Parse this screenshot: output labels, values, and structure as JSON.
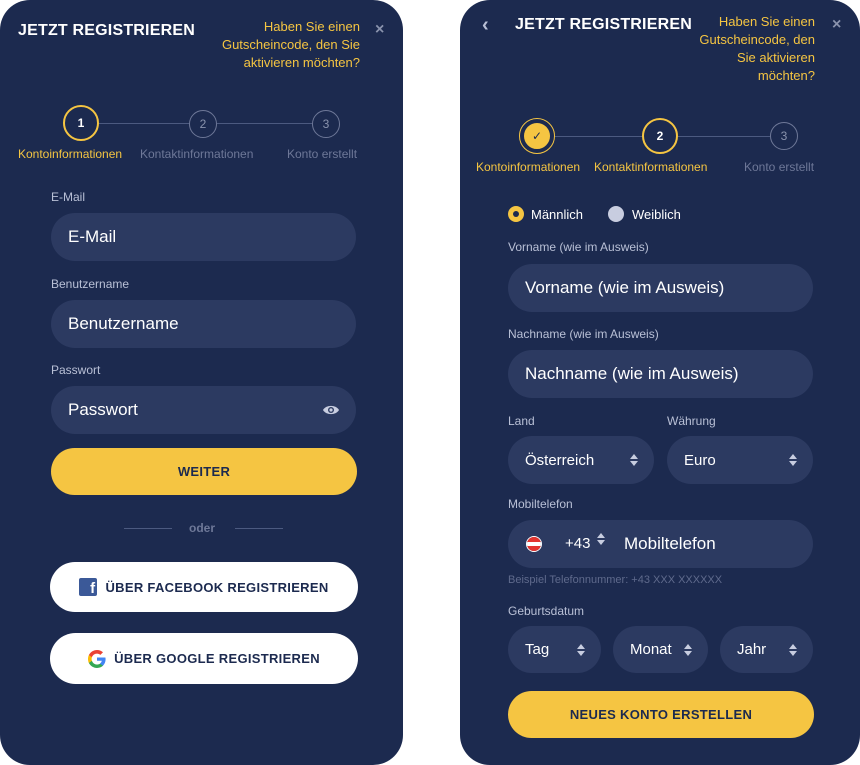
{
  "screen1": {
    "title": "JETZT REGISTRIEREN",
    "voucher_text": "Haben Sie einen Gutscheincode, den Sie aktivieren möchten?",
    "close_icon": "×",
    "steps": [
      {
        "number": "1",
        "label": "Kontoinformationen",
        "state": "active"
      },
      {
        "number": "2",
        "label": "Kontaktinformationen",
        "state": "inactive"
      },
      {
        "number": "3",
        "label": "Konto erstellt",
        "state": "inactive"
      }
    ],
    "email_label": "E-Mail",
    "email_placeholder": "E-Mail",
    "username_label": "Benutzername",
    "username_placeholder": "Benutzername",
    "password_label": "Passwort",
    "password_placeholder": "Passwort",
    "password_icon": "eye-icon",
    "continue_button": "WEITER",
    "divider_text": "oder",
    "facebook_button": "ÜBER FACEBOOK REGISTRIEREN",
    "google_button": "ÜBER GOOGLE REGISTRIEREN"
  },
  "screen2": {
    "title": "JETZT REGISTRIEREN",
    "back_icon": "‹",
    "voucher_text": "Haben Sie einen Gutscheincode, den Sie aktivieren möchten?",
    "close_icon": "×",
    "steps": [
      {
        "number": "✓",
        "label": "Kontoinformationen",
        "state": "done"
      },
      {
        "number": "2",
        "label": "Kontaktinformationen",
        "state": "active"
      },
      {
        "number": "3",
        "label": "Konto erstellt",
        "state": "inactive"
      }
    ],
    "gender_male": "Männlich",
    "gender_female": "Weiblich",
    "gender_selected": "Männlich",
    "firstname_label": "Vorname (wie im Ausweis)",
    "firstname_placeholder": "Vorname (wie im Ausweis)",
    "lastname_label": "Nachname (wie im Ausweis)",
    "lastname_placeholder": "Nachname (wie im Ausweis)",
    "country_label": "Land",
    "country_value": "Österreich",
    "currency_label": "Währung",
    "currency_value": "Euro",
    "phone_label": "Mobiltelefon",
    "phone_prefix": "+43",
    "phone_placeholder": "Mobiltelefon",
    "phone_hint": "Beispiel Telefonnummer: +43 XXX XXXXXX",
    "birthdate_label": "Geburtsdatum",
    "day_value": "Tag",
    "month_value": "Monat",
    "year_value": "Jahr",
    "create_button": "NEUES KONTO ERSTELLEN"
  },
  "colors": {
    "panel_bg": "#1c2a4f",
    "field_bg": "#2c3a61",
    "accent": "#f5c542",
    "text": "#ffffff",
    "muted": "#6e7898"
  }
}
